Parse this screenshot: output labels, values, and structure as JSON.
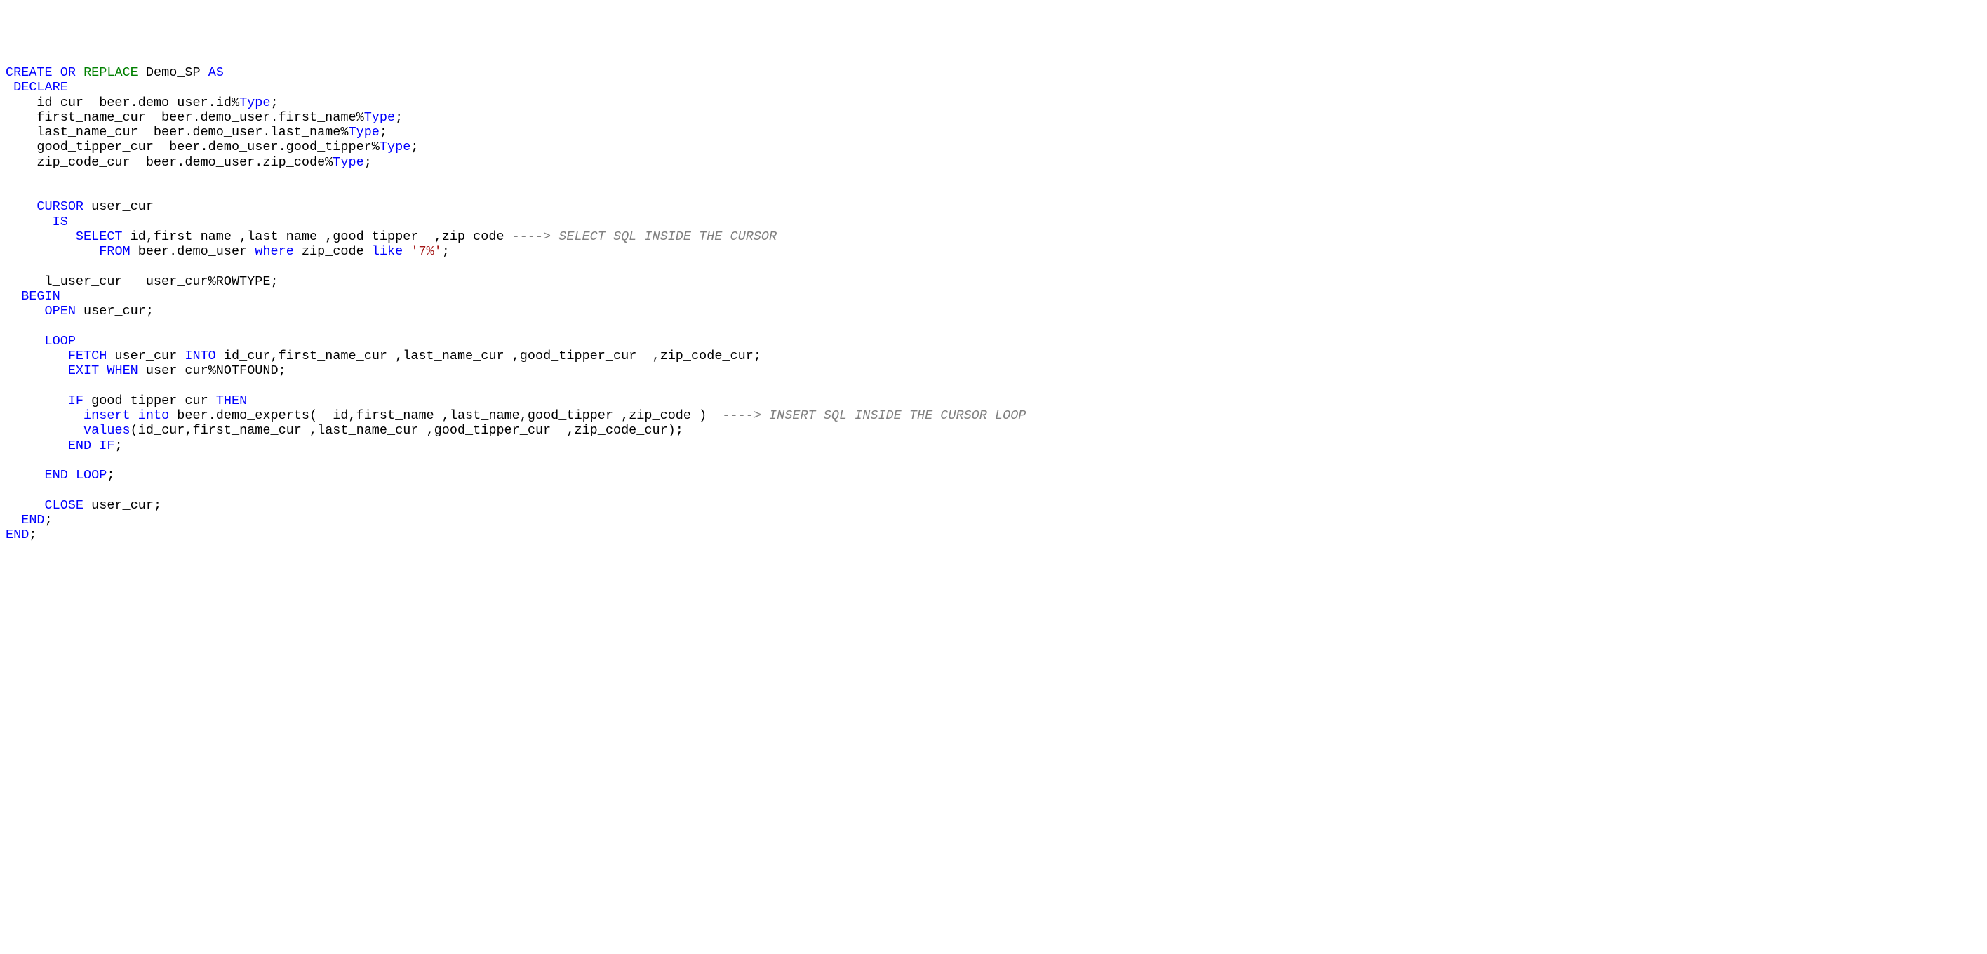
{
  "code": {
    "lines": [
      {
        "segments": [
          {
            "t": "CREATE",
            "c": "kw-blue"
          },
          {
            "t": " ",
            "c": "plain"
          },
          {
            "t": "OR",
            "c": "kw-blue"
          },
          {
            "t": " ",
            "c": "plain"
          },
          {
            "t": "REPLACE",
            "c": "kw-green"
          },
          {
            "t": " Demo_SP ",
            "c": "plain"
          },
          {
            "t": "AS",
            "c": "kw-blue"
          }
        ]
      },
      {
        "segments": [
          {
            "t": " ",
            "c": "plain"
          },
          {
            "t": "DECLARE",
            "c": "kw-blue"
          }
        ]
      },
      {
        "segments": [
          {
            "t": "    id_cur  beer.demo_user.id%",
            "c": "plain"
          },
          {
            "t": "Type",
            "c": "kw-blue"
          },
          {
            "t": ";",
            "c": "plain"
          }
        ]
      },
      {
        "segments": [
          {
            "t": "    first_name_cur  beer.demo_user.first_name%",
            "c": "plain"
          },
          {
            "t": "Type",
            "c": "kw-blue"
          },
          {
            "t": ";",
            "c": "plain"
          }
        ]
      },
      {
        "segments": [
          {
            "t": "    last_name_cur  beer.demo_user.last_name%",
            "c": "plain"
          },
          {
            "t": "Type",
            "c": "kw-blue"
          },
          {
            "t": ";",
            "c": "plain"
          }
        ]
      },
      {
        "segments": [
          {
            "t": "    good_tipper_cur  beer.demo_user.good_tipper%",
            "c": "plain"
          },
          {
            "t": "Type",
            "c": "kw-blue"
          },
          {
            "t": ";",
            "c": "plain"
          }
        ]
      },
      {
        "segments": [
          {
            "t": "    zip_code_cur  beer.demo_user.zip_code%",
            "c": "plain"
          },
          {
            "t": "Type",
            "c": "kw-blue"
          },
          {
            "t": ";",
            "c": "plain"
          }
        ]
      },
      {
        "segments": [
          {
            "t": " ",
            "c": "plain"
          }
        ]
      },
      {
        "segments": [
          {
            "t": " ",
            "c": "plain"
          }
        ]
      },
      {
        "segments": [
          {
            "t": "    ",
            "c": "plain"
          },
          {
            "t": "CURSOR",
            "c": "kw-blue"
          },
          {
            "t": " user_cur",
            "c": "plain"
          }
        ]
      },
      {
        "segments": [
          {
            "t": "      ",
            "c": "plain"
          },
          {
            "t": "IS",
            "c": "kw-blue"
          }
        ]
      },
      {
        "segments": [
          {
            "t": "         ",
            "c": "plain"
          },
          {
            "t": "SELECT",
            "c": "kw-blue"
          },
          {
            "t": " id,first_name ,last_name ,good_tipper  ,zip_code ",
            "c": "plain"
          },
          {
            "t": "----> SELECT SQL INSIDE THE CURSOR",
            "c": "comment"
          }
        ]
      },
      {
        "segments": [
          {
            "t": "            ",
            "c": "plain"
          },
          {
            "t": "FROM",
            "c": "kw-blue"
          },
          {
            "t": " beer.demo_user ",
            "c": "plain"
          },
          {
            "t": "where",
            "c": "kw-blue"
          },
          {
            "t": " zip_code ",
            "c": "plain"
          },
          {
            "t": "like",
            "c": "kw-blue"
          },
          {
            "t": " ",
            "c": "plain"
          },
          {
            "t": "'7%'",
            "c": "str-red"
          },
          {
            "t": ";",
            "c": "plain"
          }
        ]
      },
      {
        "segments": [
          {
            "t": " ",
            "c": "plain"
          }
        ]
      },
      {
        "segments": [
          {
            "t": "     l_user_cur   user_cur%ROWTYPE;",
            "c": "plain"
          }
        ]
      },
      {
        "segments": [
          {
            "t": "  ",
            "c": "plain"
          },
          {
            "t": "BEGIN",
            "c": "kw-blue"
          }
        ]
      },
      {
        "segments": [
          {
            "t": "     ",
            "c": "plain"
          },
          {
            "t": "OPEN",
            "c": "kw-blue"
          },
          {
            "t": " user_cur;",
            "c": "plain"
          }
        ]
      },
      {
        "segments": [
          {
            "t": " ",
            "c": "plain"
          }
        ]
      },
      {
        "segments": [
          {
            "t": "     ",
            "c": "plain"
          },
          {
            "t": "LOOP",
            "c": "kw-blue"
          }
        ]
      },
      {
        "segments": [
          {
            "t": "        ",
            "c": "plain"
          },
          {
            "t": "FETCH",
            "c": "kw-blue"
          },
          {
            "t": " user_cur ",
            "c": "plain"
          },
          {
            "t": "INTO",
            "c": "kw-blue"
          },
          {
            "t": " id_cur,first_name_cur ,last_name_cur ,good_tipper_cur  ,zip_code_cur;",
            "c": "plain"
          }
        ]
      },
      {
        "segments": [
          {
            "t": "        ",
            "c": "plain"
          },
          {
            "t": "EXIT",
            "c": "kw-blue"
          },
          {
            "t": " ",
            "c": "plain"
          },
          {
            "t": "WHEN",
            "c": "kw-blue"
          },
          {
            "t": " user_cur%NOTFOUND;",
            "c": "plain"
          }
        ]
      },
      {
        "segments": [
          {
            "t": " ",
            "c": "plain"
          }
        ]
      },
      {
        "segments": [
          {
            "t": "        ",
            "c": "plain"
          },
          {
            "t": "IF",
            "c": "kw-blue"
          },
          {
            "t": " good_tipper_cur ",
            "c": "plain"
          },
          {
            "t": "THEN",
            "c": "kw-blue"
          }
        ]
      },
      {
        "segments": [
          {
            "t": "          ",
            "c": "plain"
          },
          {
            "t": "insert",
            "c": "kw-blue"
          },
          {
            "t": " ",
            "c": "plain"
          },
          {
            "t": "into",
            "c": "kw-blue"
          },
          {
            "t": " beer.demo_experts(  id,first_name ,last_name,good_tipper ,zip_code )  ",
            "c": "plain"
          },
          {
            "t": "----> INSERT SQL INSIDE THE CURSOR LOOP",
            "c": "comment"
          }
        ]
      },
      {
        "segments": [
          {
            "t": "          ",
            "c": "plain"
          },
          {
            "t": "values",
            "c": "kw-blue"
          },
          {
            "t": "(id_cur,first_name_cur ,last_name_cur ,good_tipper_cur  ,zip_code_cur);",
            "c": "plain"
          }
        ]
      },
      {
        "segments": [
          {
            "t": "        ",
            "c": "plain"
          },
          {
            "t": "END",
            "c": "kw-blue"
          },
          {
            "t": " ",
            "c": "plain"
          },
          {
            "t": "IF",
            "c": "kw-blue"
          },
          {
            "t": ";",
            "c": "plain"
          }
        ]
      },
      {
        "segments": [
          {
            "t": " ",
            "c": "plain"
          }
        ]
      },
      {
        "segments": [
          {
            "t": "     ",
            "c": "plain"
          },
          {
            "t": "END",
            "c": "kw-blue"
          },
          {
            "t": " ",
            "c": "plain"
          },
          {
            "t": "LOOP",
            "c": "kw-blue"
          },
          {
            "t": ";",
            "c": "plain"
          }
        ]
      },
      {
        "segments": [
          {
            "t": " ",
            "c": "plain"
          }
        ]
      },
      {
        "segments": [
          {
            "t": "     ",
            "c": "plain"
          },
          {
            "t": "CLOSE",
            "c": "kw-blue"
          },
          {
            "t": " user_cur;",
            "c": "plain"
          }
        ]
      },
      {
        "segments": [
          {
            "t": "  ",
            "c": "plain"
          },
          {
            "t": "END",
            "c": "kw-blue"
          },
          {
            "t": ";",
            "c": "plain"
          }
        ]
      },
      {
        "segments": [
          {
            "t": "END",
            "c": "kw-blue"
          },
          {
            "t": ";",
            "c": "plain"
          }
        ]
      }
    ]
  }
}
